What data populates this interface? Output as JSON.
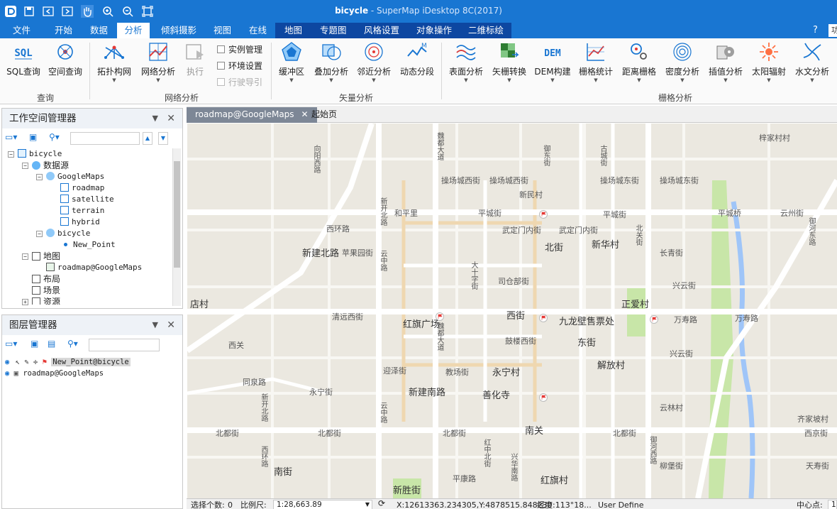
{
  "app": {
    "title_name": "bicycle",
    "title_rest": " - SuperMap iDesktop 8C(2017)"
  },
  "menus": [
    "文件",
    "开始",
    "数据",
    "分析",
    "倾斜摄影",
    "视图",
    "在线",
    "地图",
    "专题图",
    "风格设置",
    "对象操作",
    "二维标绘"
  ],
  "search_placeholder": "功",
  "ribbon": {
    "query": {
      "sql": "SQL查询",
      "spatial": "空间查询",
      "group": "查询"
    },
    "network": {
      "topo": "拓扑构网",
      "analysis": "网络分析",
      "exec": "执行",
      "instance": "实例管理",
      "env": "环境设置",
      "guide": "行驶导引",
      "group": "网络分析"
    },
    "vector": {
      "buffer": "缓冲区",
      "overlay": "叠加分析",
      "proximity": "邻近分析",
      "dynseg": "动态分段",
      "group": "矢量分析"
    },
    "raster": {
      "surface": "表面分析",
      "v2r": "矢栅转换",
      "dem": "DEM构建",
      "stats": "栅格统计",
      "dist": "距离栅格",
      "density": "密度分析",
      "interp": "插值分析",
      "solar": "太阳辐射",
      "hydro": "水文分析",
      "group": "栅格分析"
    }
  },
  "workspace_panel": {
    "title": "工作空间管理器",
    "tree": {
      "workspace": "bicycle",
      "datasources": "数据源",
      "googlemaps": "GoogleMaps",
      "gm_items": [
        "roadmap",
        "satellite",
        "terrain",
        "hybrid"
      ],
      "ds_bicycle": "bicycle",
      "new_point": "New_Point",
      "maps": "地图",
      "map_item": "roadmap@GoogleMaps",
      "layouts": "布局",
      "scenes": "场景",
      "resources": "资源"
    }
  },
  "layer_panel": {
    "title": "图层管理器",
    "layers": [
      "New_Point@bicycle",
      "roadmap@GoogleMaps"
    ]
  },
  "tabs": {
    "map_tab": "roadmap@GoogleMaps",
    "start_tab": "起始页"
  },
  "map_labels": {
    "zijiacun": "梓家村村",
    "caochang_xi": "操场城西街",
    "caochang_xi2": "操场城西街",
    "caochang_dong": "操场城东街",
    "caochang_dong2": "操场城东街",
    "xinmincun": "新民村",
    "hepingli": "和平里",
    "pingcheng1": "平城街",
    "pingcheng2": "平城街",
    "pingchengqiao": "平城桥",
    "yunzhou": "云州街",
    "wuding_w": "武定门内街",
    "wuding_e": "武定门内街",
    "beijie": "北街",
    "xinhuacun": "新华村",
    "xinjianbeilu": "新建北路",
    "pingguoyuan": "苹果园街",
    "changqing": "长青街",
    "xingyun1": "兴云街",
    "xingyun2": "兴云街",
    "sicangzheng": "司仓部街",
    "zhengaicun": "正爱村",
    "qingyuan": "清远西街",
    "hongqi": "红旗广场",
    "xijie": "西街",
    "jiulong": "九龙壁售票处",
    "wanshou1": "万寿路",
    "wanshou2": "万寿路",
    "gulouxi": "鼓楼西街",
    "dongjie": "东街",
    "jiefangcun": "解放村",
    "yingze": "迎泽街",
    "jiaochang": "教场街",
    "yongningcun": "永宁村",
    "yongning": "永宁街",
    "xinjiannanlu": "新建南路",
    "shanhuasi": "善化寺",
    "yunlincun": "云林村",
    "qipocun": "齐家坡村",
    "beidu1": "北都街",
    "beidu2": "北都街",
    "beidu3": "北都街",
    "beidu4": "北都街",
    "xijing": "西京街",
    "nanguan": "南关",
    "nanjie": "南街",
    "liubao": "柳堡街",
    "tianshou": "天寿街",
    "pingkang": "平康路",
    "xinshengjie": "新胜街",
    "hongqicun": "红旗村",
    "dianecun": "店村",
    "xiguan": "西关",
    "xihuanlu": "西环路",
    "tongyuan": "同泉路",
    "weiduxi": "魏都大道",
    "xinkaibeilu": "新开北路",
    "yunzhonglu": "云中路",
    "daxizhi": "大十字街",
    "xiangyang": "向阳西路",
    "yudong": "御东街",
    "hexi": "御河西路",
    "guxie": "古城街",
    "weidu_s": "魏都大道",
    "yuhe_e": "御河东路",
    "beiguanjie": "北关街",
    "xinkaibei": "新开北路",
    "yunzhong2": "云中路",
    "xihuan2": "西环路",
    "hongzhong": "红中北街",
    "xingshou": "兴华南路"
  },
  "status": {
    "selected_label": "选择个数:",
    "selected_value": "0",
    "scale_label": "比例尺:",
    "scale_value": "1:28,663.89",
    "coords": "X:12613363.234305,Y:4878515.848230",
    "lonlat": "经度:113°18...",
    "projection": "User Define",
    "center_label": "中心点:",
    "center_value": "1"
  }
}
